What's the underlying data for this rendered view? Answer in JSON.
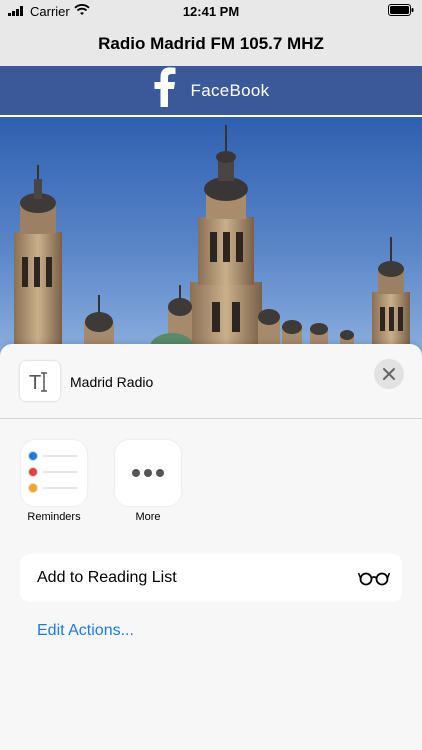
{
  "status_bar": {
    "carrier": "Carrier",
    "time": "12:41 PM"
  },
  "nav": {
    "title": "Radio Madrid FM 105.7 MHZ"
  },
  "facebook_bar": {
    "icon": "facebook-icon",
    "label": "FaceBook",
    "color": "#3b5998"
  },
  "share_sheet": {
    "title": "Madrid Radio",
    "doc_icon": "text-document-icon",
    "apps": [
      {
        "label": "Reminders",
        "icon": "reminders-icon"
      },
      {
        "label": "More",
        "icon": "more-icon"
      }
    ],
    "actions": [
      {
        "label": "Add to Reading List",
        "icon": "reading-glasses-icon"
      }
    ],
    "edit_actions_label": "Edit Actions...",
    "accent": "#1a7ce6"
  }
}
